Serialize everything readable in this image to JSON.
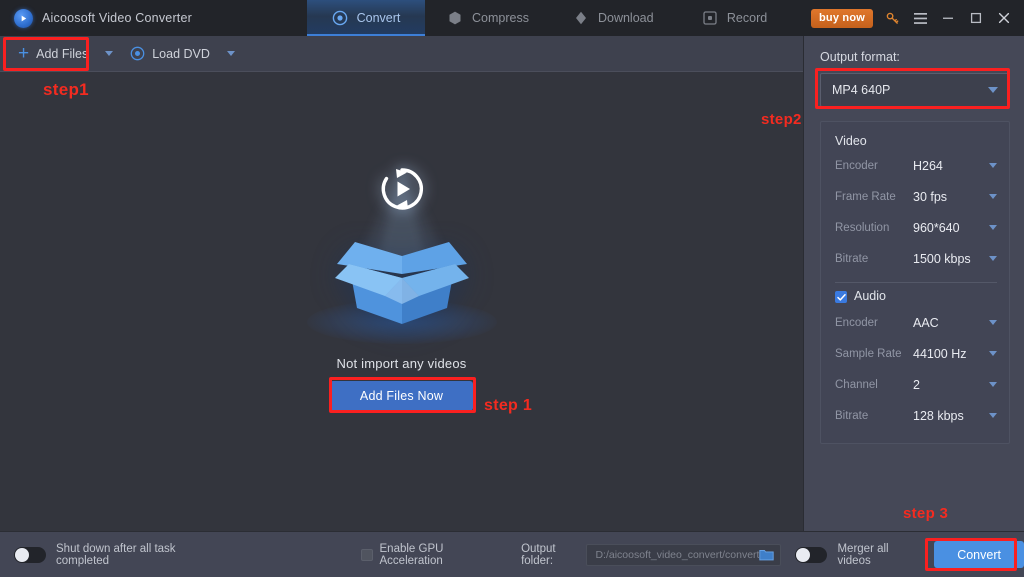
{
  "app": {
    "title": "Aicoosoft Video Converter",
    "logo_icon": "play-circle-icon"
  },
  "tabs": [
    {
      "label": "Convert",
      "icon": "convert-icon",
      "active": true
    },
    {
      "label": "Compress",
      "icon": "compress-icon",
      "active": false
    },
    {
      "label": "Download",
      "icon": "download-icon",
      "active": false
    },
    {
      "label": "Record",
      "icon": "record-icon",
      "active": false
    }
  ],
  "window_controls": {
    "buy_now": "buy now",
    "key_icon": "key-icon",
    "menu_icon": "hamburger-menu-icon",
    "minimize_icon": "minimize-icon",
    "maximize_icon": "maximize-icon",
    "close_icon": "close-icon"
  },
  "toolbar": {
    "add_files": "Add Files",
    "add_files_icon": "plus-icon",
    "add_files_caret": "chevron-down-icon",
    "load_dvd": "Load DVD",
    "load_dvd_icon": "disc-icon",
    "load_dvd_caret": "chevron-down-icon"
  },
  "empty_state": {
    "artwork_icon": "open-box-with-refresh-icon",
    "message": "Not import any videos",
    "button": "Add Files Now"
  },
  "output_panel": {
    "label": "Output format:",
    "format": "MP4 640P",
    "format_caret": "chevron-down-icon",
    "video": {
      "title": "Video",
      "rows": [
        {
          "key": "Encoder",
          "value": "H264"
        },
        {
          "key": "Frame Rate",
          "value": "30 fps"
        },
        {
          "key": "Resolution",
          "value": "960*640"
        },
        {
          "key": "Bitrate",
          "value": "1500 kbps"
        }
      ]
    },
    "audio": {
      "title": "Audio",
      "checked": true,
      "check_icon": "checkmark-icon",
      "rows": [
        {
          "key": "Encoder",
          "value": "AAC"
        },
        {
          "key": "Sample Rate",
          "value": "44100 Hz"
        },
        {
          "key": "Channel",
          "value": "2"
        },
        {
          "key": "Bitrate",
          "value": "128 kbps"
        }
      ]
    }
  },
  "bottom_bar": {
    "shutdown_label": "Shut down after all task completed",
    "shutdown_on": false,
    "gpu_label": "Enable GPU Acceleration",
    "gpu_checked": false,
    "output_folder_label": "Output folder:",
    "output_folder_path": "D:/aicoosoft_video_convert/convert",
    "folder_icon": "folder-icon",
    "merger_label": "Merger all videos",
    "merger_on": false,
    "convert_button": "Convert"
  },
  "annotations": {
    "accent_color": "#fa2020",
    "step1_toolbar": "step1",
    "step1_button": "step 1",
    "step2": "step2",
    "step3": "step 3"
  }
}
